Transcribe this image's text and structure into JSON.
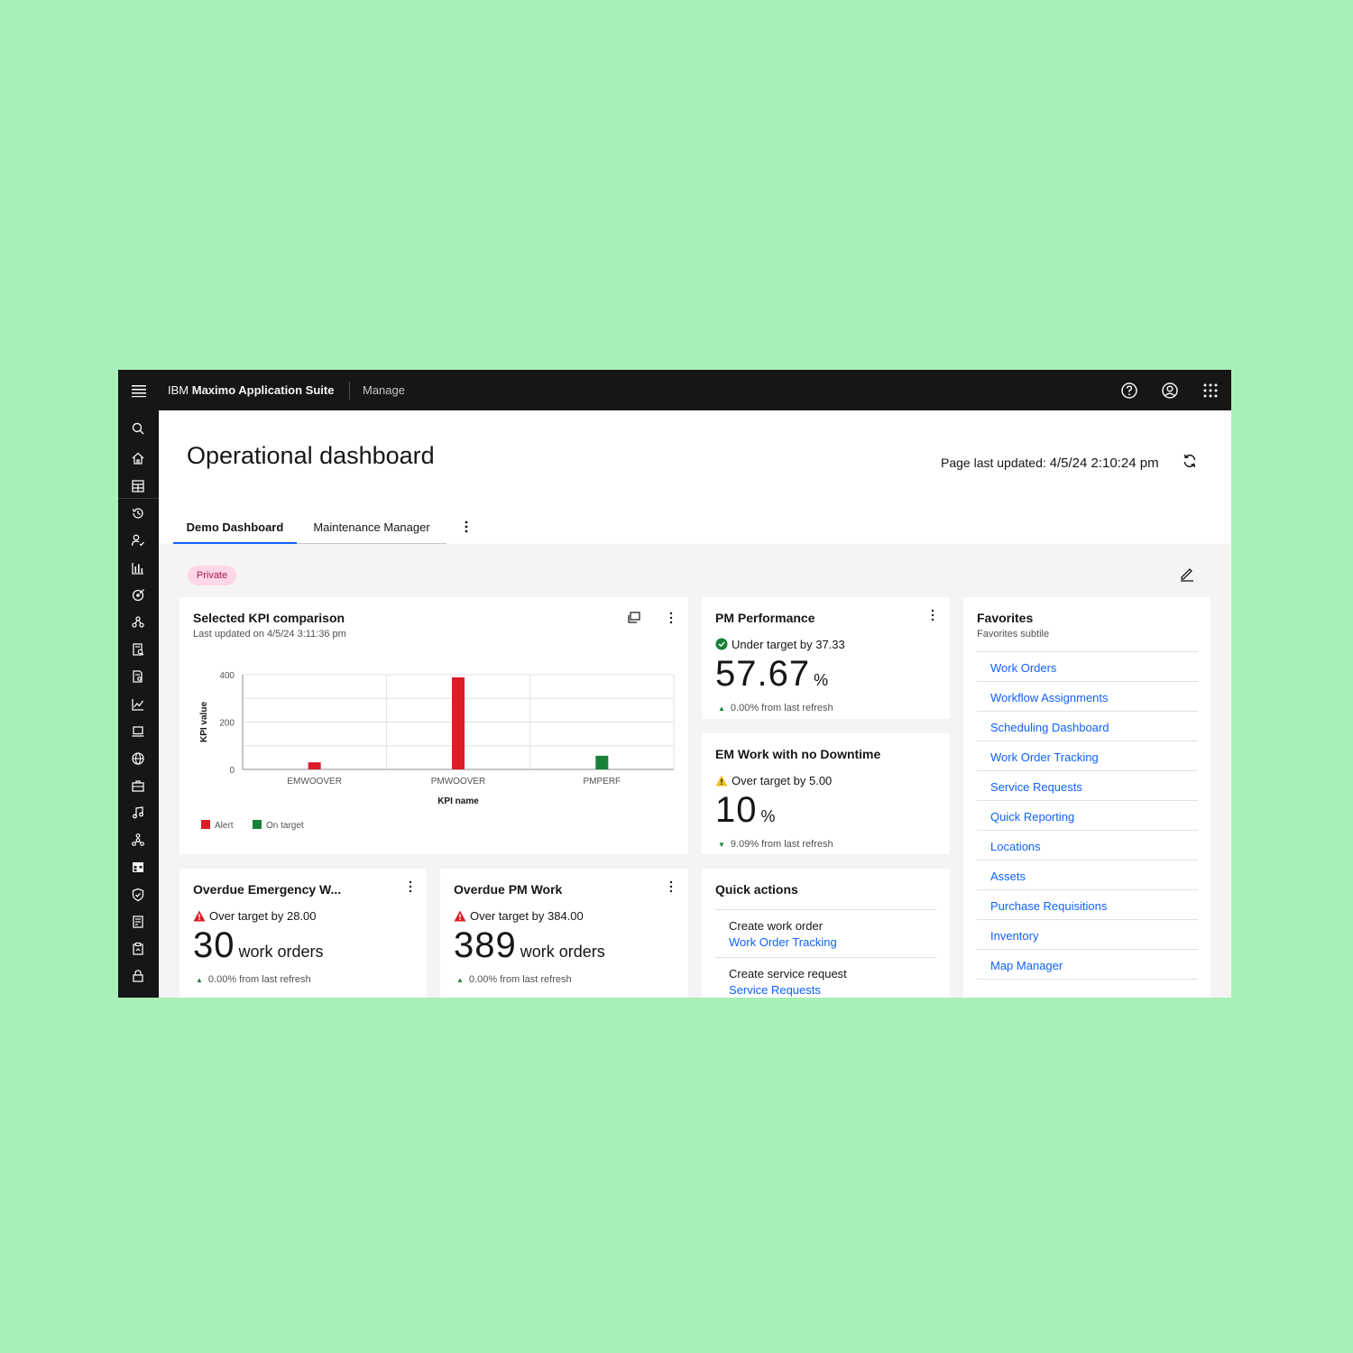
{
  "topbar": {
    "brand_prefix": "IBM",
    "brand_name": "Maximo Application Suite",
    "app_name": "Manage",
    "icons": [
      "menu-icon",
      "help-icon",
      "user-avatar-icon",
      "app-switcher-icon"
    ]
  },
  "sidenav": {
    "icons": [
      "search-icon",
      "home-icon",
      "dashboard-icon",
      "history-icon",
      "user-check-icon",
      "bar-chart-icon",
      "satellite-icon",
      "network-icon",
      "report-icon",
      "document-search-icon",
      "line-chart-icon",
      "laptop-icon",
      "globe-icon",
      "briefcase-icon",
      "music-icon",
      "hierarchy-icon",
      "calendar-icon",
      "shield-icon",
      "receipt-icon",
      "clipboard-icon",
      "lock-icon"
    ]
  },
  "header": {
    "title": "Operational dashboard",
    "updated_label": "Page last updated:",
    "updated_value": "4/5/24 2:10:24 pm"
  },
  "tabs": [
    {
      "label": "Demo Dashboard",
      "selected": true
    },
    {
      "label": "Maintenance Manager",
      "selected": false
    }
  ],
  "private_tag": "Private",
  "kpi_card": {
    "title": "Selected KPI comparison",
    "subtitle": "Last updated on 4/5/24 3:11:36 pm"
  },
  "chart_data": {
    "type": "bar",
    "title": "Selected KPI comparison",
    "categories": [
      "EMWOOVER",
      "PMWOOVER",
      "PMPERF"
    ],
    "values": [
      30,
      389,
      57.67
    ],
    "bar_status": [
      "Alert",
      "Alert",
      "On target"
    ],
    "xlabel": "KPI name",
    "ylabel": "KPI value",
    "ylim": [
      0,
      400
    ],
    "yticks": [
      "0",
      "200",
      "400"
    ],
    "grid": true,
    "legend": [
      {
        "name": "Alert",
        "color": "#da1e28"
      },
      {
        "name": "On target",
        "color": "#198038"
      }
    ],
    "legend_position": "bottom-left"
  },
  "pm_performance": {
    "title": "PM Performance",
    "status": "Under target by 37.33",
    "value": "57.67",
    "unit": "%",
    "delta": "0.00% from last refresh",
    "delta_dir": "up"
  },
  "em_downtime": {
    "title": "EM Work with no Downtime",
    "status": "Over target by 5.00",
    "value": "10",
    "unit": "%",
    "delta": "9.09% from last refresh",
    "delta_dir": "down"
  },
  "overdue_em": {
    "title": "Overdue Emergency W...",
    "status": "Over target by 28.00",
    "value": "30",
    "unit": "work orders",
    "delta": "0.00% from last refresh"
  },
  "overdue_pm": {
    "title": "Overdue PM Work",
    "status": "Over target by 384.00",
    "value": "389",
    "unit": "work orders",
    "delta": "0.00% from last refresh"
  },
  "quick_actions": {
    "title": "Quick actions",
    "items": [
      {
        "label": "Create work order",
        "link": "Work Order Tracking"
      },
      {
        "label": "Create service request",
        "link": "Service Requests"
      }
    ]
  },
  "favorites": {
    "title": "Favorites",
    "subtitle": "Favorites subtile",
    "items": [
      "Work Orders",
      "Workflow Assignments",
      "Scheduling Dashboard",
      "Work Order Tracking",
      "Service Requests",
      "Quick Reporting",
      "Locations",
      "Assets",
      "Purchase Requisitions",
      "Inventory",
      "Map Manager"
    ]
  },
  "colors": {
    "brand_blue": "#0f62fe",
    "alert_red": "#da1e28",
    "ok_green": "#198038",
    "warning_yellow": "#f1c21b",
    "shell_dark": "#161616"
  }
}
